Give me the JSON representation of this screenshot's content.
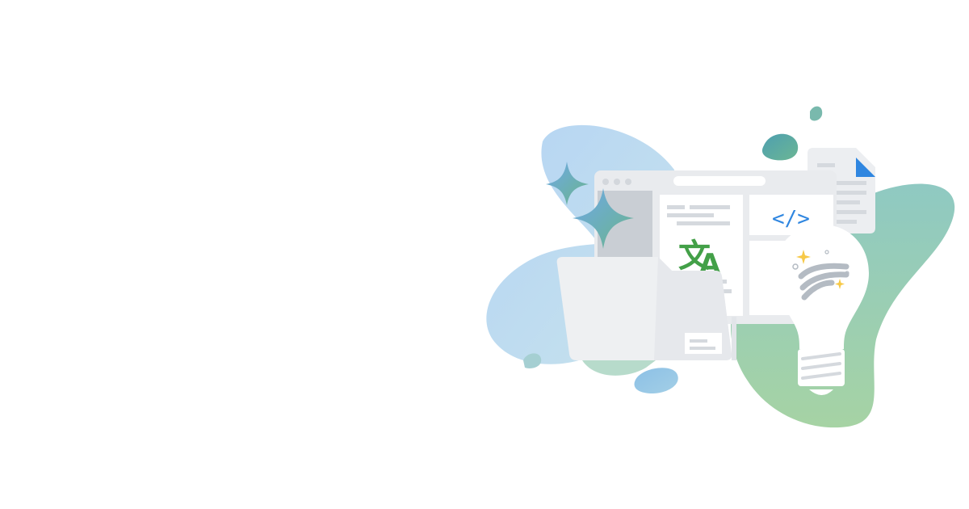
{
  "illustration": {
    "translate_glyph_han": "文",
    "translate_glyph_latin": "A",
    "code_tag": "</>",
    "icons": [
      "sparkle-icon",
      "browser-window",
      "translate-icon",
      "code-icon",
      "folder-icon",
      "document-icon",
      "lightbulb-icon",
      "data-waves-icon"
    ]
  },
  "colors": {
    "blue_blob": "#b9d7f2",
    "green_blob": "#9ccfb7",
    "teal_accent": "#5eaa9d",
    "translate_green": "#43a048",
    "code_blue": "#2f86e0",
    "sparkle_yellow": "#f7c948",
    "window_gray": "#e9ebee",
    "panel_gray": "#c9ced4"
  }
}
